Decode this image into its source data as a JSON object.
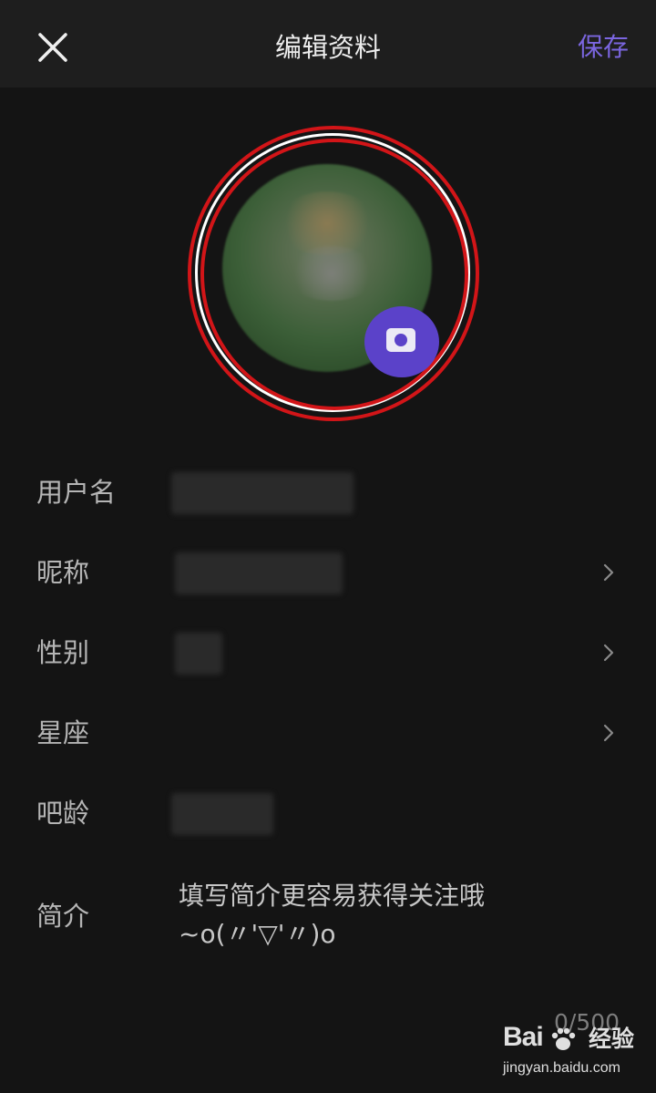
{
  "header": {
    "title": "编辑资料",
    "save_label": "保存"
  },
  "form": {
    "username_label": "用户名",
    "nickname_label": "昵称",
    "gender_label": "性别",
    "constellation_label": "星座",
    "tieba_age_label": "吧龄",
    "intro_label": "简介",
    "intro_placeholder": "填写简介更容易获得关注哦\n~o(〃'▽'〃)o",
    "intro_counter": "0/500"
  },
  "watermark": {
    "brand": "Bai",
    "brand_cn": "经验",
    "url": "jingyan.baidu.com"
  },
  "colors": {
    "accent": "#7b66e0",
    "background": "#141414",
    "header_bg": "#1e1e1e",
    "highlight_ring": "#d21518",
    "camera_badge": "#5b42c9"
  },
  "icons": {
    "close": "close-icon",
    "camera": "camera-icon",
    "chevron": "chevron-right-icon"
  }
}
